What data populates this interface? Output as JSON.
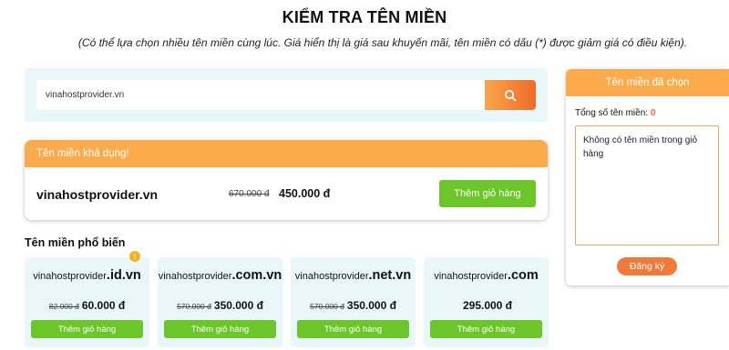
{
  "header": {
    "title": "KIỂM TRA TÊN MIỀN",
    "subtitle": "(Có thể lựa chọn nhiều tên miền cùng lúc. Giá hiển thị là giá sau khuyến mãi, tên miền có dấu (*) được giảm giá có điều kiện)."
  },
  "search": {
    "value": "vinahostprovider.vn",
    "button_icon": "search-icon"
  },
  "available": {
    "heading": "Tên miền khả dụng!",
    "domain": "vinahostprovider.vn",
    "old_price": "670.000 đ",
    "new_price": "450.000 đ",
    "button_label": "Thêm giỏ hàng"
  },
  "popular": {
    "heading": "Tên miền phổ biến",
    "items": [
      {
        "name": "vinahostprovider",
        "tld": ".id.vn",
        "old_price": "82.000 đ",
        "new_price": "60.000 đ",
        "button_label": "Thêm giỏ hàng",
        "badge": "!"
      },
      {
        "name": "vinahostprovider",
        "tld": ".com.vn",
        "old_price": "570.000 đ",
        "new_price": "350.000 đ",
        "button_label": "Thêm giỏ hàng"
      },
      {
        "name": "vinahostprovider",
        "tld": ".net.vn",
        "old_price": "570.000 đ",
        "new_price": "350.000 đ",
        "button_label": "Thêm giỏ hàng"
      },
      {
        "name": "vinahostprovider",
        "tld": ".com",
        "old_price": "",
        "new_price": "295.000 đ",
        "button_label": "Thêm giỏ hàng"
      }
    ]
  },
  "cart": {
    "heading": "Tên miền đã chọn",
    "count_label": "Tổng số tên miền:",
    "count_value": "0",
    "empty_text": "Không có tên miền trong giỏ hàng",
    "register_label": "Đăng ký"
  },
  "colors": {
    "accent_orange": "#fbab4c",
    "button_green": "#6cc62a",
    "panel_bg": "#eaf7fa"
  }
}
